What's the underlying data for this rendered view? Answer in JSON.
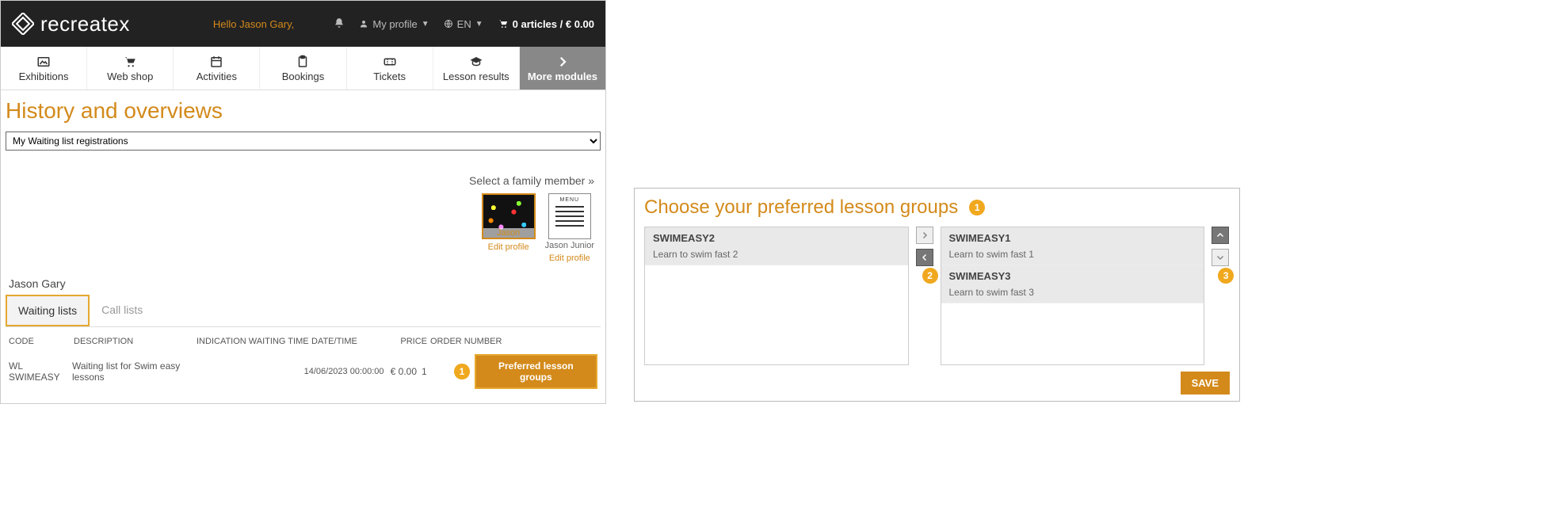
{
  "topbar": {
    "logo_text": "recreatex",
    "greeting": "Hello Jason Gary,",
    "my_profile": "My profile",
    "lang": "EN",
    "cart": "0 articles / € 0.00"
  },
  "nav": {
    "items": [
      {
        "label": "Exhibitions"
      },
      {
        "label": "Web shop"
      },
      {
        "label": "Activities"
      },
      {
        "label": "Bookings"
      },
      {
        "label": "Tickets"
      },
      {
        "label": "Lesson results"
      }
    ],
    "more": "More modules"
  },
  "page": {
    "title": "History and overviews",
    "select_value": "My Waiting list registrations",
    "family_label": "Select a family member »",
    "family": [
      {
        "name": "Jason",
        "edit": "Edit profile"
      },
      {
        "name": "Jason Junior",
        "edit": "Edit profile"
      }
    ],
    "user_name": "Jason Gary",
    "tabs": {
      "waiting": "Waiting lists",
      "call": "Call lists"
    },
    "columns": {
      "code": "CODE",
      "desc": "DESCRIPTION",
      "ind": "INDICATION WAITING TIME",
      "dt": "DATE/TIME",
      "price": "PRICE",
      "order": "ORDER NUMBER"
    },
    "row": {
      "code": "WL SWIMEASY",
      "desc": "Waiting list for Swim easy lessons",
      "ind": "",
      "dt": "14/06/2023 00:00:00",
      "price": "€ 0.00",
      "order": "1"
    },
    "badges": {
      "one": "1"
    },
    "preferred_btn": "Preferred lesson groups"
  },
  "dialog": {
    "title": "Choose your preferred lesson groups",
    "badges": {
      "one": "1",
      "two": "2",
      "three": "3"
    },
    "left": [
      {
        "title": "SWIMEASY2",
        "sub": "Learn to swim fast 2"
      }
    ],
    "right": [
      {
        "title": "SWIMEASY1",
        "sub": "Learn to swim fast 1"
      },
      {
        "title": "SWIMEASY3",
        "sub": "Learn to swim fast 3"
      }
    ],
    "save": "SAVE"
  }
}
